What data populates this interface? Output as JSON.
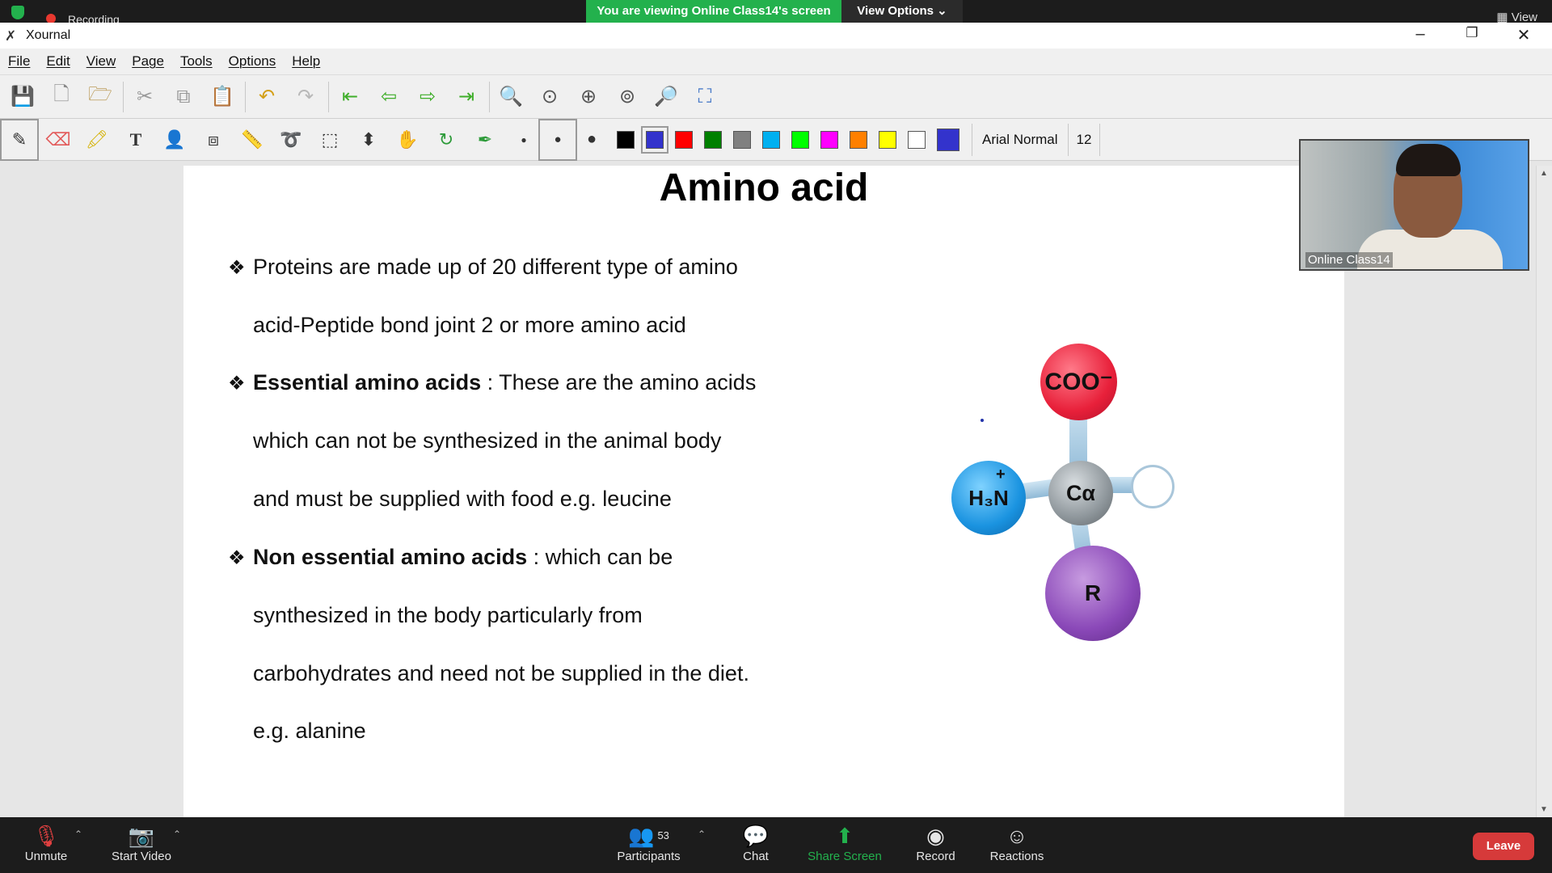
{
  "zoom_top": {
    "recording_label": "Recording",
    "share_banner": "You are viewing Online Class14's screen",
    "view_options": "View Options ⌄",
    "view_label": "View"
  },
  "window": {
    "title": "Xournal",
    "menus": [
      "File",
      "Edit",
      "View",
      "Page",
      "Tools",
      "Options",
      "Help"
    ]
  },
  "toolbar2": {
    "font": "Arial Normal",
    "size": "12",
    "colors": [
      "#000000",
      "#3333cc",
      "#ff0000",
      "#008000",
      "#808080",
      "#00b0f0",
      "#00ff00",
      "#ff00ff",
      "#ff8000",
      "#ffff00",
      "#ffffff",
      "#3333cc"
    ]
  },
  "slide": {
    "title": "Amino acid",
    "bullet_symbol": "❖",
    "lines": [
      {
        "bold": "",
        "text": "Proteins are made up of 20 different type of amino"
      },
      {
        "bold": "",
        "text": "acid-Peptide bond joint 2 or more amino acid"
      },
      {
        "bold": "Essential amino acids",
        "text": " : These are the amino acids"
      },
      {
        "bold": "",
        "text": "which can not be synthesized in the animal body"
      },
      {
        "bold": "",
        "text": "and must be supplied with food e.g. leucine"
      },
      {
        "bold": "Non essential amino acids",
        "text": " : which can be"
      },
      {
        "bold": "",
        "text": "synthesized in the body particularly from"
      },
      {
        "bold": "",
        "text": "carbohydrates and need not be supplied in the diet."
      },
      {
        "bold": "",
        "text": "e.g. alanine"
      }
    ],
    "molecule": {
      "top_atom": "COO⁻",
      "center_atom": "Cα",
      "left_atom": "H₃N",
      "left_charge": "+",
      "bottom_atom": "R"
    }
  },
  "camera": {
    "participant_name": "Online Class14"
  },
  "zoom_bottom": {
    "unmute": "Unmute",
    "start_video": "Start Video",
    "participants": "Participants",
    "participants_count": "53",
    "chat": "Chat",
    "share_screen": "Share Screen",
    "record": "Record",
    "reactions": "Reactions",
    "leave": "Leave"
  }
}
